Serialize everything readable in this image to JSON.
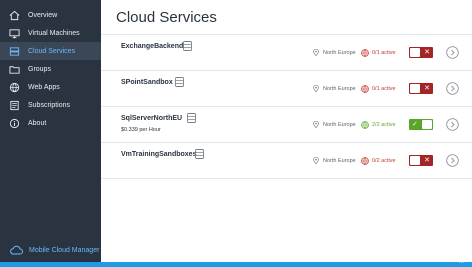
{
  "sidebar": {
    "items": [
      {
        "label": "Overview",
        "icon": "home-icon"
      },
      {
        "label": "Virtual Machines",
        "icon": "monitor-icon"
      },
      {
        "label": "Cloud Services",
        "icon": "cloud-services-icon",
        "active": true
      },
      {
        "label": "Groups",
        "icon": "folder-icon"
      },
      {
        "label": "Web Apps",
        "icon": "web-apps-icon"
      },
      {
        "label": "Subscriptions",
        "icon": "subscriptions-icon"
      },
      {
        "label": "About",
        "icon": "info-icon"
      }
    ],
    "brand": "Mobile Cloud Manager"
  },
  "main": {
    "title": "Cloud Services",
    "services": [
      {
        "name": "ExchangeBackend",
        "price": "",
        "location": "North Europe",
        "status": "0/1 active",
        "status_color": "#c0392b",
        "enabled": false
      },
      {
        "name": "SPointSandbox",
        "price": "",
        "location": "North Europe",
        "status": "0/1 active",
        "status_color": "#c0392b",
        "enabled": false
      },
      {
        "name": "SqlServerNorthEU",
        "price": "$0.339 per Hour",
        "location": "North Europe",
        "status": "2/2 active",
        "status_color": "#5aa52b",
        "enabled": true
      },
      {
        "name": "VmTrainingSandboxes",
        "price": "",
        "location": "North Europe",
        "status": "0/2 active",
        "status_color": "#c0392b",
        "enabled": false
      }
    ]
  },
  "bottombar": {
    "dots": "..."
  },
  "colors": {
    "sidebar_bg": "#2a3340",
    "accent": "#1e9be8",
    "toggle_off": "#a32626",
    "toggle_on": "#5aa52b"
  }
}
